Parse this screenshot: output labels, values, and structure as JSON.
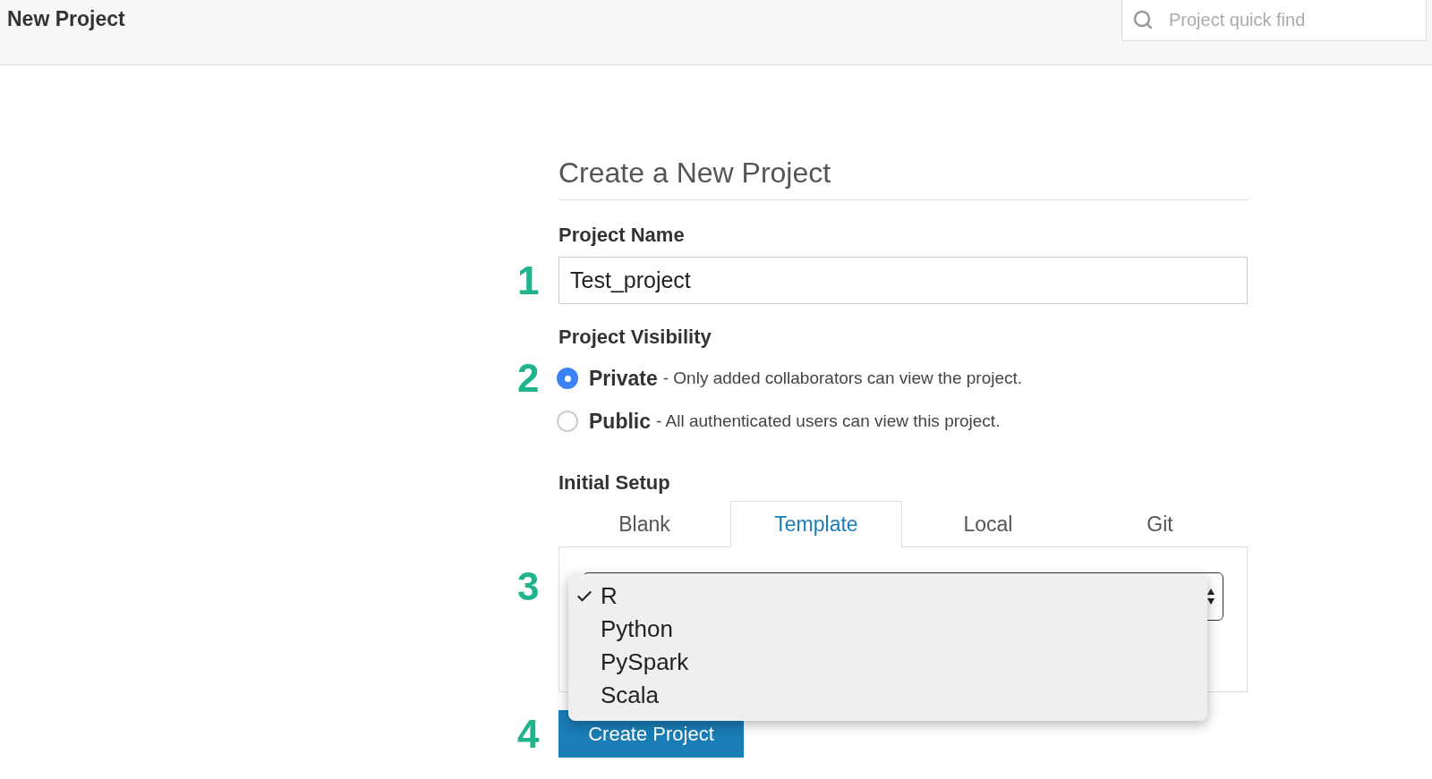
{
  "header": {
    "title": "New Project",
    "search": {
      "placeholder": "Project quick find"
    }
  },
  "form": {
    "heading": "Create a New Project",
    "project_name": {
      "step": "1",
      "label": "Project Name",
      "value": "Test_project"
    },
    "visibility": {
      "step": "2",
      "label": "Project Visibility",
      "options": [
        {
          "label": "Private",
          "description": "- Only added collaborators can view the project.",
          "selected": true
        },
        {
          "label": "Public",
          "description": "- All authenticated users can view this project.",
          "selected": false
        }
      ]
    },
    "initial_setup": {
      "step": "3",
      "label": "Initial Setup",
      "tabs": [
        {
          "label": "Blank",
          "selected": false
        },
        {
          "label": "Template",
          "selected": true
        },
        {
          "label": "Local",
          "selected": false
        },
        {
          "label": "Git",
          "selected": false
        }
      ],
      "template_menu": [
        {
          "label": "R",
          "selected": true
        },
        {
          "label": "Python",
          "selected": false
        },
        {
          "label": "PySpark",
          "selected": false
        },
        {
          "label": "Scala",
          "selected": false
        }
      ]
    },
    "submit": {
      "step": "4",
      "label": "Create Project"
    }
  }
}
